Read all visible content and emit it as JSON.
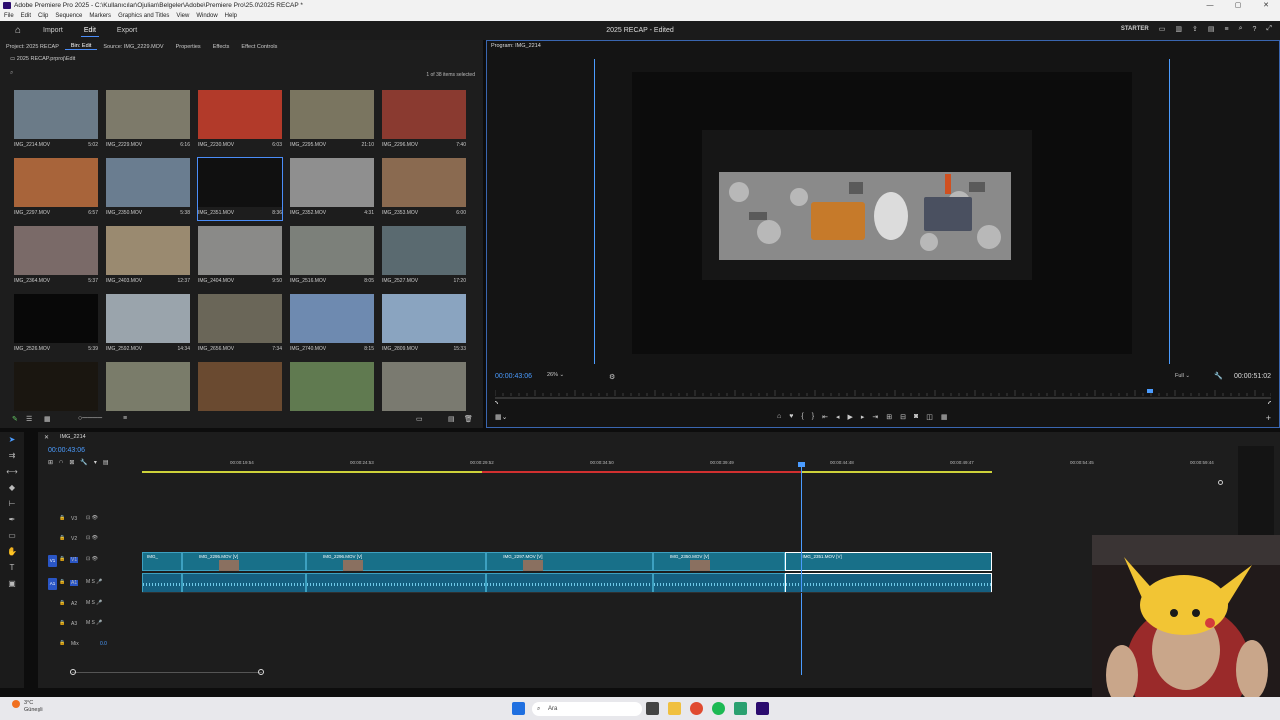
{
  "window": {
    "title": "Adobe Premiere Pro 2025 - C:\\Kullanıcılar\\Ojulian\\Belgeler\\Adobe\\Premiere Pro\\25.0\\2025 RECAP *",
    "controls": [
      "—",
      "▢",
      "✕"
    ]
  },
  "menu": [
    "File",
    "Edit",
    "Clip",
    "Sequence",
    "Markers",
    "Graphics and Titles",
    "View",
    "Window",
    "Help"
  ],
  "header": {
    "workspaces": [
      "Import",
      "Edit",
      "Export"
    ],
    "active_workspace": "Edit",
    "center_title": "2025 RECAP - Edited",
    "starter_label": "STARTER"
  },
  "project_panel": {
    "tabs": [
      "Project: 2025 RECAP",
      "Bin: Edit",
      "Source: IMG_2229.MOV",
      "Properties",
      "Effects",
      "Effect Controls"
    ],
    "active_tab": "Bin: Edit",
    "path": "2025 RECAP.prproj\\Edit",
    "search_placeholder": "",
    "count": "1 of 38 items selected",
    "items": [
      {
        "name": "IMG_2214.MOV",
        "duration": "5:02",
        "color": "#6b7b88"
      },
      {
        "name": "IMG_2229.MOV",
        "duration": "6:16",
        "color": "#7d7a6a"
      },
      {
        "name": "IMG_2230.MOV",
        "duration": "6:03",
        "color": "#b23a2a"
      },
      {
        "name": "IMG_2295.MOV",
        "duration": "21:10",
        "color": "#7a7560"
      },
      {
        "name": "IMG_2296.MOV",
        "duration": "7:40",
        "color": "#8a3a30"
      },
      {
        "name": "IMG_2297.MOV",
        "duration": "6:57",
        "color": "#a8643a"
      },
      {
        "name": "IMG_2350.MOV",
        "duration": "5:38",
        "color": "#6a7d90"
      },
      {
        "name": "IMG_2351.MOV",
        "duration": "8:36",
        "color": "#101010"
      },
      {
        "name": "IMG_2352.MOV",
        "duration": "4:31",
        "color": "#8f8f8f"
      },
      {
        "name": "IMG_2353.MOV",
        "duration": "6:00",
        "color": "#8a6a50"
      },
      {
        "name": "IMG_2364.MOV",
        "duration": "5:37",
        "color": "#7a6a68"
      },
      {
        "name": "IMG_2403.MOV",
        "duration": "12:37",
        "color": "#9a8a70"
      },
      {
        "name": "IMG_2404.MOV",
        "duration": "9:50",
        "color": "#8a8a88"
      },
      {
        "name": "IMG_2516.MOV",
        "duration": "8:05",
        "color": "#7c807a"
      },
      {
        "name": "IMG_2527.MOV",
        "duration": "17:20",
        "color": "#5a6a70"
      },
      {
        "name": "IMG_2526.MOV",
        "duration": "5:39",
        "color": "#080808"
      },
      {
        "name": "IMG_2592.MOV",
        "duration": "14:34",
        "color": "#9aa4ac"
      },
      {
        "name": "IMG_2656.MOV",
        "duration": "7:34",
        "color": "#6a6658"
      },
      {
        "name": "IMG_2740.MOV",
        "duration": "8:15",
        "color": "#6e8ab0"
      },
      {
        "name": "IMG_2809.MOV",
        "duration": "15:33",
        "color": "#8aa4c0"
      },
      {
        "name": "",
        "duration": "",
        "color": "#1a1610"
      },
      {
        "name": "",
        "duration": "",
        "color": "#7a7c6a"
      },
      {
        "name": "",
        "duration": "",
        "color": "#6a4a30"
      },
      {
        "name": "",
        "duration": "",
        "color": "#607a50"
      },
      {
        "name": "",
        "duration": "",
        "color": "#7a7a70"
      }
    ],
    "selected_index": 7
  },
  "program": {
    "tab": "Program: IMG_2214",
    "timecode": "00:00:43:06",
    "zoom": "26%",
    "quality": "Full",
    "duration": "00:00:51:02"
  },
  "timeline": {
    "tab": "IMG_2214",
    "timecode": "00:00:43:06",
    "ruler_labels": [
      "00:00:19:54",
      "00:00:24:53",
      "00:00:29:52",
      "00:00:34:50",
      "00:00:39:49",
      "00:00:44:48",
      "00:00:49:47",
      "00:00:54:45",
      "00:00:59:44"
    ],
    "tracks": [
      {
        "label": "V3",
        "kind": "video"
      },
      {
        "label": "V2",
        "kind": "video"
      },
      {
        "label": "V1",
        "kind": "video",
        "source": "V1"
      },
      {
        "label": "A1",
        "kind": "audio",
        "source": "A1"
      },
      {
        "label": "A2",
        "kind": "audio"
      },
      {
        "label": "A3",
        "kind": "audio"
      },
      {
        "label": "Mix",
        "kind": "mix",
        "value": "0.0"
      }
    ],
    "clips": [
      {
        "name": "IMG_",
        "start": 0,
        "end": 0.047
      },
      {
        "name": "IMG_2295.MOV [V]",
        "start": 0.047,
        "end": 0.193
      },
      {
        "name": "IMG_2296.MOV [V]",
        "start": 0.193,
        "end": 0.405
      },
      {
        "name": "IMG_2297.MOV [V]",
        "start": 0.405,
        "end": 0.601
      },
      {
        "name": "IMG_2350.MOV [V]",
        "start": 0.601,
        "end": 0.757
      },
      {
        "name": "IMG_2351.MOV [V]",
        "start": 0.757,
        "end": 1.0
      }
    ]
  },
  "taskbar": {
    "weather_temp": "3°C",
    "weather_text": "Güneşli",
    "search_placeholder": "Ara"
  }
}
